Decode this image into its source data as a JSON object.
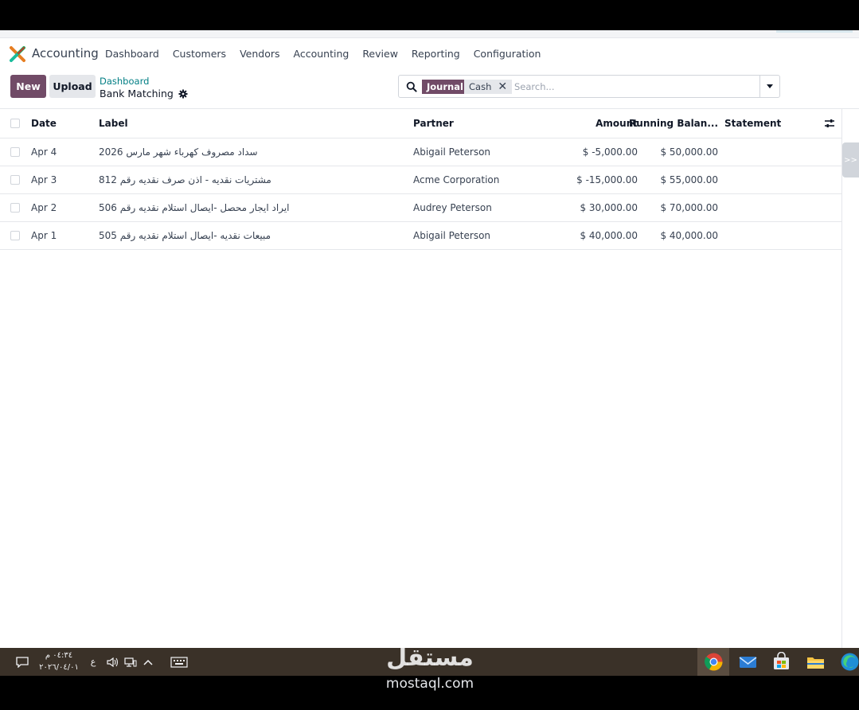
{
  "app": {
    "brand": "Accounting",
    "menu": [
      "Dashboard",
      "Customers",
      "Vendors",
      "Accounting",
      "Review",
      "Reporting",
      "Configuration"
    ]
  },
  "control": {
    "new_label": "New",
    "upload_label": "Upload",
    "breadcrumb_parent": "Dashboard",
    "breadcrumb_current": "Bank Matching"
  },
  "search": {
    "facet_label": "Journal",
    "facet_value": "Cash",
    "placeholder": "Search..."
  },
  "table": {
    "columns": {
      "date": "Date",
      "label": "Label",
      "partner": "Partner",
      "amount": "Amount",
      "running": "Running Balan...",
      "statement": "Statement"
    },
    "rows": [
      {
        "date": "Apr 4",
        "label": "سداد مصروف كهرباء شهر مارس 2026",
        "partner": "Abigail Peterson",
        "amount": "$ -5,000.00",
        "running": "$ 50,000.00",
        "statement": ""
      },
      {
        "date": "Apr 3",
        "label": "مشتريات نقديه - اذن صرف نقديه رقم 812",
        "partner": "Acme Corporation",
        "amount": "$ -15,000.00",
        "running": "$ 55,000.00",
        "statement": ""
      },
      {
        "date": "Apr 2",
        "label": "ايراد ايجار محصل -ايصال استلام نقديه رقم 506",
        "partner": "Audrey Peterson",
        "amount": "$ 30,000.00",
        "running": "$ 70,000.00",
        "statement": ""
      },
      {
        "date": "Apr 1",
        "label": "مبيعات نقديه -ايصال استلام نقديه رقم 505",
        "partner": "Abigail Peterson",
        "amount": "$ 40,000.00",
        "running": "$ 40,000.00",
        "statement": ""
      }
    ]
  },
  "side_handle": ">>",
  "taskbar": {
    "time": "٠٤:٣٤ م",
    "date": "٢٠٢٦/٠٤/٠١",
    "lang": "ع"
  },
  "watermark": {
    "text": "مستقل",
    "sub": "mostaql.com"
  },
  "colors": {
    "primary": "#714b67",
    "link": "#017e84",
    "taskbar": "#3a3128"
  }
}
